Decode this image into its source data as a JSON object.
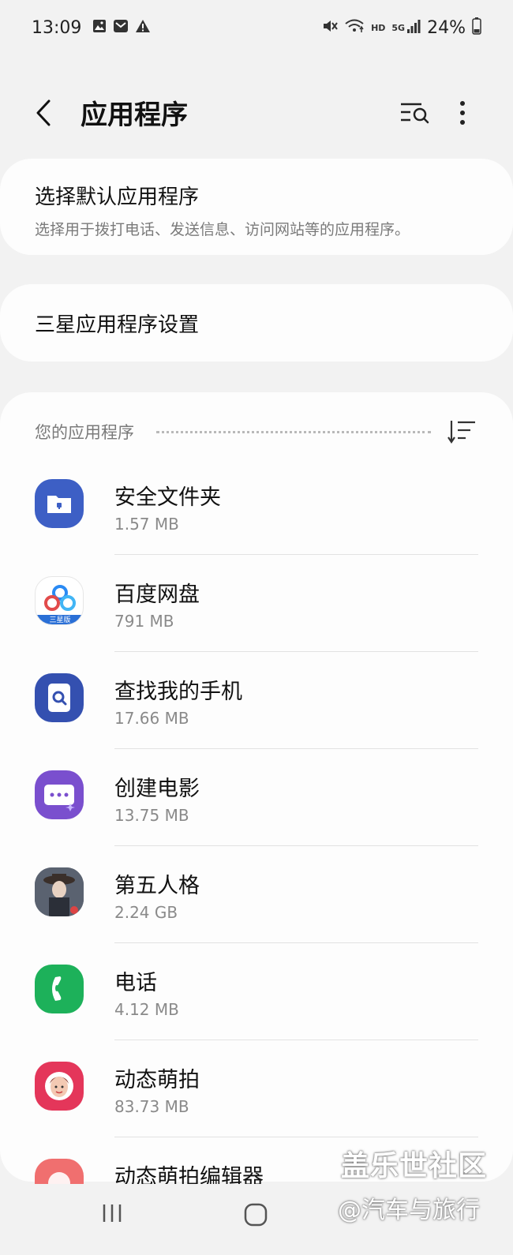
{
  "status": {
    "time": "13:09",
    "battery_percent": "24%",
    "network": "5G",
    "hd": "HD",
    "left_icons": [
      "image-icon",
      "email-icon",
      "warning-icon"
    ],
    "right_icons": [
      "mute-icon",
      "wifi-icon",
      "signal-icon",
      "battery-icon"
    ]
  },
  "header": {
    "title": "应用程序"
  },
  "default_apps": {
    "title": "选择默认应用程序",
    "subtitle": "选择用于拨打电话、发送信息、访问网站等的应用程序。"
  },
  "samsung_settings": {
    "title": "三星应用程序设置"
  },
  "apps_section": {
    "label": "您的应用程序",
    "items": [
      {
        "name": "安全文件夹",
        "size": "1.57 MB",
        "icon": "secure-folder-icon",
        "color": "#3d5fc5"
      },
      {
        "name": "百度网盘",
        "size": "791 MB",
        "icon": "baidu-netdisk-icon",
        "color": "#2a8af4",
        "badge": "三星版"
      },
      {
        "name": "查找我的手机",
        "size": "17.66 MB",
        "icon": "find-my-mobile-icon",
        "color": "#3450b0"
      },
      {
        "name": "创建电影",
        "size": "13.75 MB",
        "icon": "movie-creator-icon",
        "color": "#7a4fce"
      },
      {
        "name": "第五人格",
        "size": "2.24 GB",
        "icon": "identity-v-icon",
        "color": "#4c5460"
      },
      {
        "name": "电话",
        "size": "4.12 MB",
        "icon": "phone-icon",
        "color": "#1db15a"
      },
      {
        "name": "动态萌拍",
        "size": "83.73 MB",
        "icon": "ar-emoji-icon",
        "color": "#e4365a"
      },
      {
        "name": "动态萌拍编辑器",
        "size": "",
        "icon": "ar-emoji-editor-icon",
        "color": "#f06f6f"
      }
    ]
  },
  "watermark": {
    "line1": "盖乐世社区",
    "line2": "@汽车与旅行"
  }
}
